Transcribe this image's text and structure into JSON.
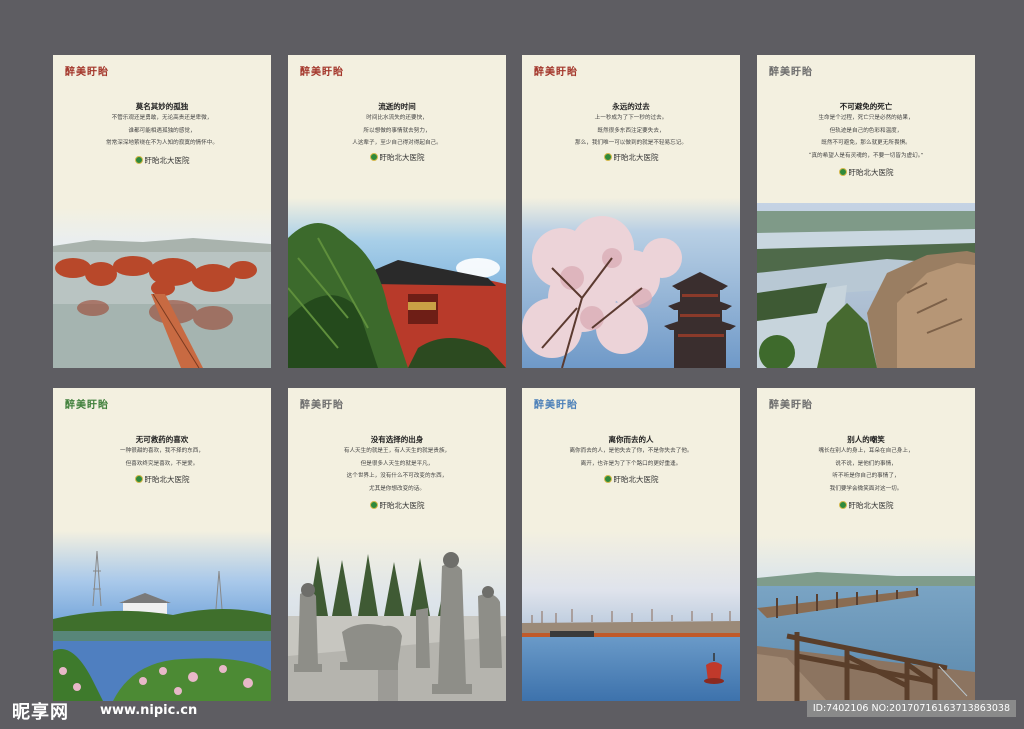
{
  "colors": {
    "background": "#5e5d62",
    "card": "#f3f0e0",
    "brand_red": "#a3352a",
    "brand_gray": "#6d6d6d",
    "brand_green": "#3f7f3a",
    "brand_blue": "#4a7fb8"
  },
  "hospital_name": "盱眙北大医院",
  "cards": [
    {
      "brand": "醉美盱眙",
      "brand_color": "#a3352a",
      "title": "莫名其妙的孤独",
      "lines": [
        "不管乐观还是勇敢，无论高贵还是卑微，",
        "谁都可能相遇孤独的感觉，",
        "常常深深地萦绕在不为人知的寂寞的情怀中。"
      ],
      "photo": "red-trees-lake-boardwalk-icon"
    },
    {
      "brand": "醉美盱眙",
      "brand_color": "#a3352a",
      "title": "流逝的时间",
      "lines": [
        "时间比水流失的还要快，",
        "所以想做的事情就去努力，",
        "人这辈子，至少自己得对得起自己。"
      ],
      "photo": "pine-and-temple-icon"
    },
    {
      "brand": "醉美盱眙",
      "brand_color": "#a3352a",
      "title": "永远的过去",
      "lines": [
        "上一秒成为了下一秒的过去。",
        "既然很多东西注定要失去，",
        "那么，我们唯一可以做到的就是不轻易忘记。"
      ],
      "photo": "blossom-and-pagoda-icon"
    },
    {
      "brand": "醉美盱眙",
      "brand_color": "#6d6d6d",
      "title": "不可避免的死亡",
      "lines": [
        "生命是个过程，死亡只是必然的结果，",
        "但轨迹是自己的色彩和温度，",
        "既然不可避免，那么就更无所畏惧。",
        "“真的希望人是有灵魂的，不要一切皆为虚幻。”"
      ],
      "photo": "cliff-and-river-icon"
    },
    {
      "brand": "醉美盱眙",
      "brand_color": "#3f7f3a",
      "title": "无可救药的喜欢",
      "lines": [
        "一种很甜的喜欢，我不择的东西，",
        "但喜欢终究是喜欢，不是爱。"
      ],
      "photo": "pond-and-flowers-icon"
    },
    {
      "brand": "醉美盱眙",
      "brand_color": "#6d6d6d",
      "title": "没有选择的出身",
      "lines": [
        "有人天生的就是王，有人天生的就是贵族，",
        "但是很多人天生的就是平凡，",
        "这个世界上，没有什么不可改变的东西，",
        "尤其是你想改变的话。"
      ],
      "photo": "stone-statues-icon"
    },
    {
      "brand": "醉美盱眙",
      "brand_color": "#4a7fb8",
      "title": "离你而去的人",
      "lines": [
        "离你而去的人，是他失去了你，不是你失去了他。",
        "离开，也许是为了下个路口的更好重逢。"
      ],
      "photo": "lake-and-buoy-icon"
    },
    {
      "brand": "醉美盱眙",
      "brand_color": "#6d6d6d",
      "title": "别人的嘲笑",
      "lines": [
        "嘴长在别人的身上，耳朵在自己身上，",
        "说不说，是他们的事情，",
        "听不听是你自己的事情了，",
        "我们要学会微笑面对这一切。"
      ],
      "photo": "wooden-pier-icon"
    }
  ],
  "footer": {
    "site_logo": "昵享网",
    "site_url": "www.nipic.cn",
    "image_id": "ID:7402106 NO:20170716163713863038"
  }
}
